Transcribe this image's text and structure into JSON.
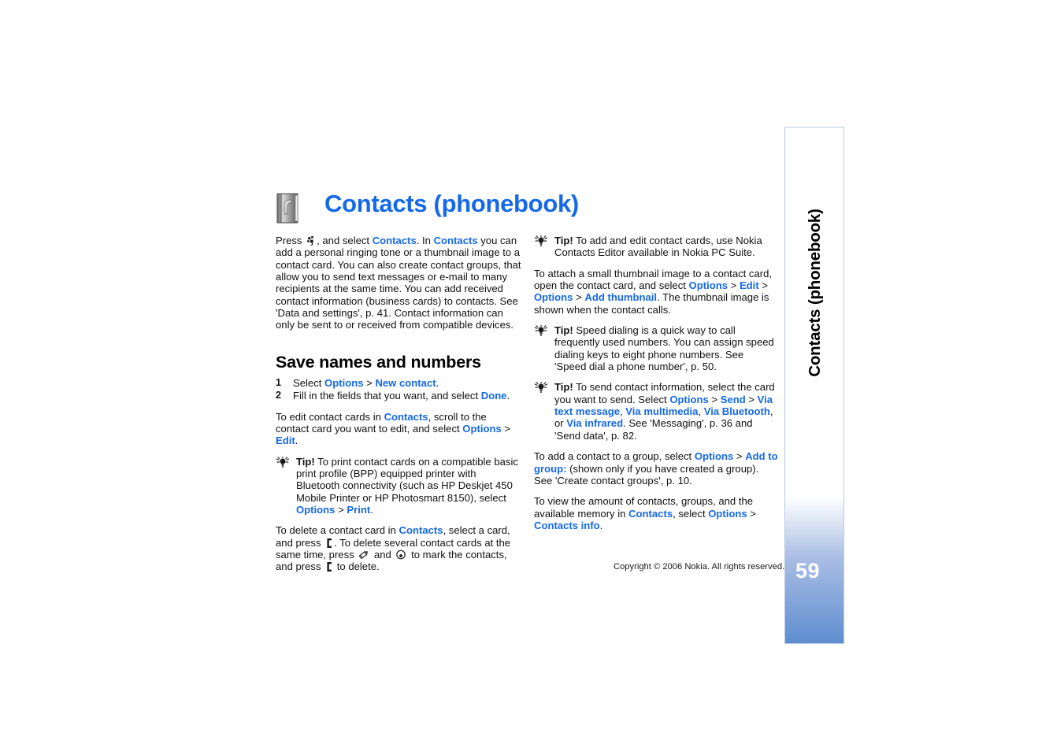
{
  "document": {
    "title": "Contacts (phonebook)",
    "icon": "address-book-icon",
    "accent_color": "#1569e8",
    "side_tab": {
      "label": "Contacts (phonebook)",
      "page_number": "59",
      "border_color": "#b8cbe6",
      "gradient_end_color": "#3b72c4"
    },
    "footer": {
      "copyright": "Copyright © 2006 Nokia. All rights reserved."
    }
  },
  "left_column": {
    "intro": {
      "t1": "Press ",
      "key_icon": "menu-key-icon",
      "t2": ", and select ",
      "l1": "Contacts",
      "t3": ". In ",
      "l2": "Contacts",
      "t4": " you can add a personal ringing tone or a thumbnail image to a contact card. You can also create contact groups, that allow you to send text messages or e-mail to many recipients at the same time. You can add received contact information (business cards) to contacts. See 'Data and settings', p. 41. Contact information can only be sent to or received from compatible devices."
    },
    "section_heading": "Save names and numbers",
    "steps": [
      {
        "num": "1",
        "t1": "Select ",
        "l1": "Options",
        "sep": " > ",
        "l2": "New contact",
        "t2": "."
      },
      {
        "num": "2",
        "t1": "Fill in the fields that you want, and select ",
        "l1": "Done",
        "t2": "."
      }
    ],
    "edit_para": {
      "t1": "To edit contact cards in ",
      "l1": "Contacts",
      "t2": ", scroll to the contact card you want to edit, and select ",
      "l2": "Options",
      "sep": " > ",
      "l3": "Edit",
      "t3": "."
    },
    "print_tip": {
      "tip_word": "Tip!",
      "t1": " To print contact cards on a compatible basic print profile (BPP) equipped printer with Bluetooth connectivity (such as HP Deskjet 450 Mobile Printer or HP Photosmart 8150), select ",
      "l1": "Options",
      "sep": " > ",
      "l2": "Print",
      "t2": "."
    },
    "delete_para": {
      "t1": "To delete a contact card in ",
      "l1": "Contacts",
      "t2": ", select a card, and press ",
      "key1": "clear-key-icon",
      "t3": ". To delete several contact cards at the same time, press ",
      "key2": "edit-key-icon",
      "t4": " and ",
      "key3": "scroll-key-icon",
      "t5": " to mark the contacts, and press ",
      "key4": "clear-key-icon",
      "t6": " to delete."
    }
  },
  "right_column": {
    "editor_tip": {
      "tip_word": "Tip!",
      "t1": " To add and edit contact cards, use Nokia Contacts Editor available in Nokia PC Suite."
    },
    "thumbnail_para": {
      "t1": "To attach a small thumbnail image to a contact card, open the contact card, and select ",
      "l1": "Options",
      "sep1": " > ",
      "l2": "Edit",
      "sep2": " > ",
      "l3": "Options",
      "sep3": " > ",
      "l4": "Add thumbnail",
      "t2": ". The thumbnail image is shown when the contact calls."
    },
    "speed_dial_tip": {
      "tip_word": "Tip!",
      "t1": " Speed dialing is a quick way to call frequently used numbers. You can assign speed dialing keys to eight phone numbers. See 'Speed dial a phone number', p. 50."
    },
    "send_tip": {
      "tip_word": "Tip!",
      "t1": " To send contact information, select the card you want to send. Select ",
      "l1": "Options",
      "sep1": " > ",
      "l2": "Send",
      "sep2": " > ",
      "l3": "Via text message",
      "c1": ", ",
      "l4": "Via multimedia",
      "c2": ", ",
      "l5": "Via Bluetooth",
      "c3": ", or ",
      "l6": "Via infrared",
      "t2": ". See 'Messaging', p. 36 and 'Send data', p. 82."
    },
    "group_para": {
      "t1": "To add a contact to a group, select ",
      "l1": "Options",
      "sep": " > ",
      "l2": "Add to group:",
      "t2": " (shown only if you have created a group). See 'Create contact groups', p. 10."
    },
    "memory_para": {
      "t1": "To view the amount of contacts, groups, and the available memory in ",
      "l1": "Contacts",
      "t2": ", select ",
      "l2": "Options",
      "sep": " > ",
      "l3": "Contacts info",
      "t3": "."
    }
  }
}
